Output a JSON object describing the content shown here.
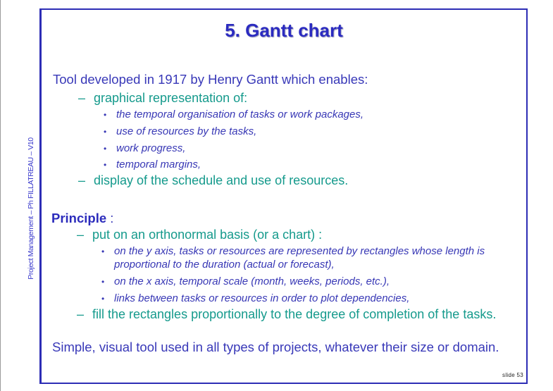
{
  "side_label": "Project Management – Ph FILLATREAU – V10",
  "title": "5. Gantt chart",
  "intro": "Tool developed in 1917 by Henry Gantt which enables:",
  "dash": "–",
  "bullet": "•",
  "section1": {
    "items": [
      "graphical representation of:",
      "display of the schedule and use of resources."
    ],
    "subitems": [
      "the temporal organisation of tasks or work packages,",
      "use of resources by the tasks,",
      "work progress,",
      "temporal margins,"
    ]
  },
  "principle": {
    "label": "Principle",
    "suffix": " :",
    "items": [
      "put on an orthonormal basis (or a chart) :",
      "fill the rectangles proportionally to the degree of completion of the tasks."
    ],
    "subitems": [
      "on the y axis, tasks or resources are represented by rectangles whose length is",
      "proportional to the duration (actual or forecast),",
      "on the x axis, temporal scale (month, weeks, periods, etc.),",
      "links between tasks or resources in order to plot dependencies,"
    ]
  },
  "closing": "Simple, visual tool used in all types of projects, whatever their size or domain.",
  "slide_number": "slide 53"
}
